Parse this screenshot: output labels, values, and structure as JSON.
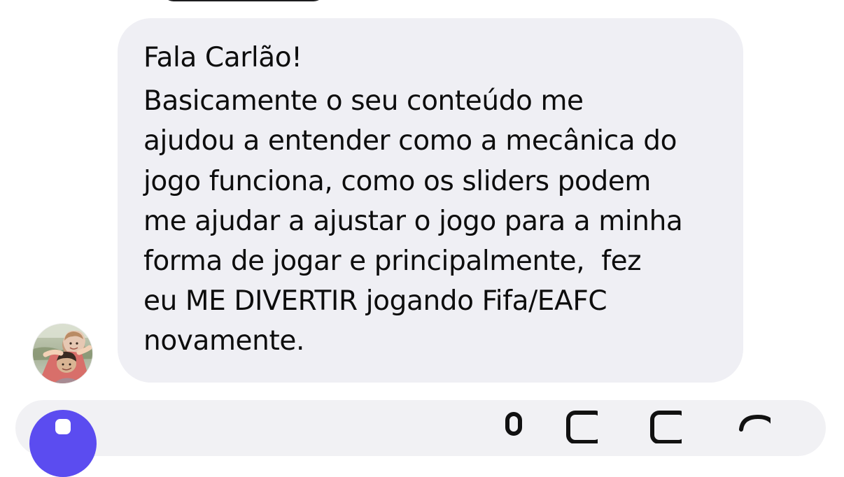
{
  "message": {
    "lines": [
      "Fala Carlão!",
      "Basicamente o seu conteúdo me",
      "ajudou a entender como a mecânica do",
      "jogo funciona, como os sliders podem",
      "me ajudar a ajustar o jogo para a minha",
      "forma de jogar e principalmente,  fez",
      "eu ME DIVERTIR jogando Fifa/EAFC",
      "novamente."
    ]
  },
  "avatar": {
    "icon": "sender-avatar-photo"
  },
  "composer": {
    "icons": [
      "add-icon",
      "microphone-icon",
      "image-icon",
      "sticker-icon",
      "emoji-icon"
    ]
  },
  "colors": {
    "bubble": "#efeff4",
    "composer": "#f1f1f4",
    "accent": "#5b4cf0"
  }
}
